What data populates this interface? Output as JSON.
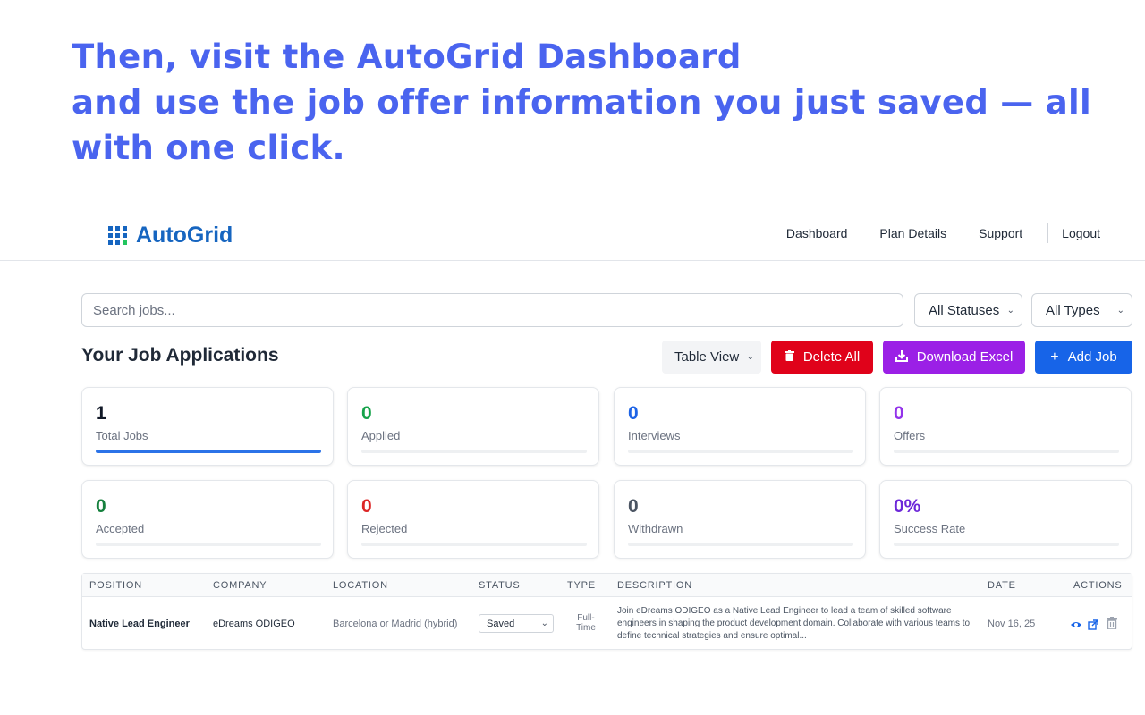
{
  "promo": {
    "line1": "Then, visit the AutoGrid Dashboard",
    "line2": "and use the job offer information you just saved — all",
    "line3": "with one click."
  },
  "nav": {
    "brand": "AutoGrid",
    "links": [
      "Dashboard",
      "Plan Details",
      "Support"
    ],
    "logout": "Logout"
  },
  "filters": {
    "search_placeholder": "Search jobs...",
    "status": "All Statuses",
    "type": "All Types"
  },
  "section": {
    "title": "Your Job Applications",
    "view": "Table View",
    "delete_all": "Delete All",
    "download_excel": "Download Excel",
    "add_job": "Add Job"
  },
  "stats": [
    {
      "value": "1",
      "label": "Total Jobs",
      "color": "#111827",
      "progress": 1
    },
    {
      "value": "0",
      "label": "Applied",
      "color": "#16a34a",
      "progress": 0
    },
    {
      "value": "0",
      "label": "Interviews",
      "color": "#1e64e6",
      "progress": 0
    },
    {
      "value": "0",
      "label": "Offers",
      "color": "#9333ea",
      "progress": 0
    },
    {
      "value": "0",
      "label": "Accepted",
      "color": "#15803d",
      "progress": 0
    },
    {
      "value": "0",
      "label": "Rejected",
      "color": "#dc2626",
      "progress": 0
    },
    {
      "value": "0",
      "label": "Withdrawn",
      "color": "#4b5563",
      "progress": 0
    },
    {
      "value": "0%",
      "label": "Success Rate",
      "color": "#6d28d9",
      "progress": 0
    }
  ],
  "table": {
    "columns": [
      "POSITION",
      "COMPANY",
      "LOCATION",
      "STATUS",
      "TYPE",
      "DESCRIPTION",
      "DATE",
      "ACTIONS"
    ],
    "rows": [
      {
        "position": "Native Lead Engineer",
        "company": "eDreams ODIGEO",
        "location": "Barcelona or Madrid (hybrid)",
        "status": "Saved",
        "type_line1": "Full-",
        "type_line2": "Time",
        "description": "Join eDreams ODIGEO as a Native Lead Engineer to lead a team of skilled software engineers in shaping the product development domain. Collaborate with various teams to define technical strategies and ensure optimal...",
        "date": "Nov 16, 25"
      }
    ]
  },
  "colors": {
    "promo": "#4a64ef",
    "brand": "#1665c0",
    "delete": "#e0021a",
    "excel": "#9b20e6",
    "add": "#1764e8"
  }
}
